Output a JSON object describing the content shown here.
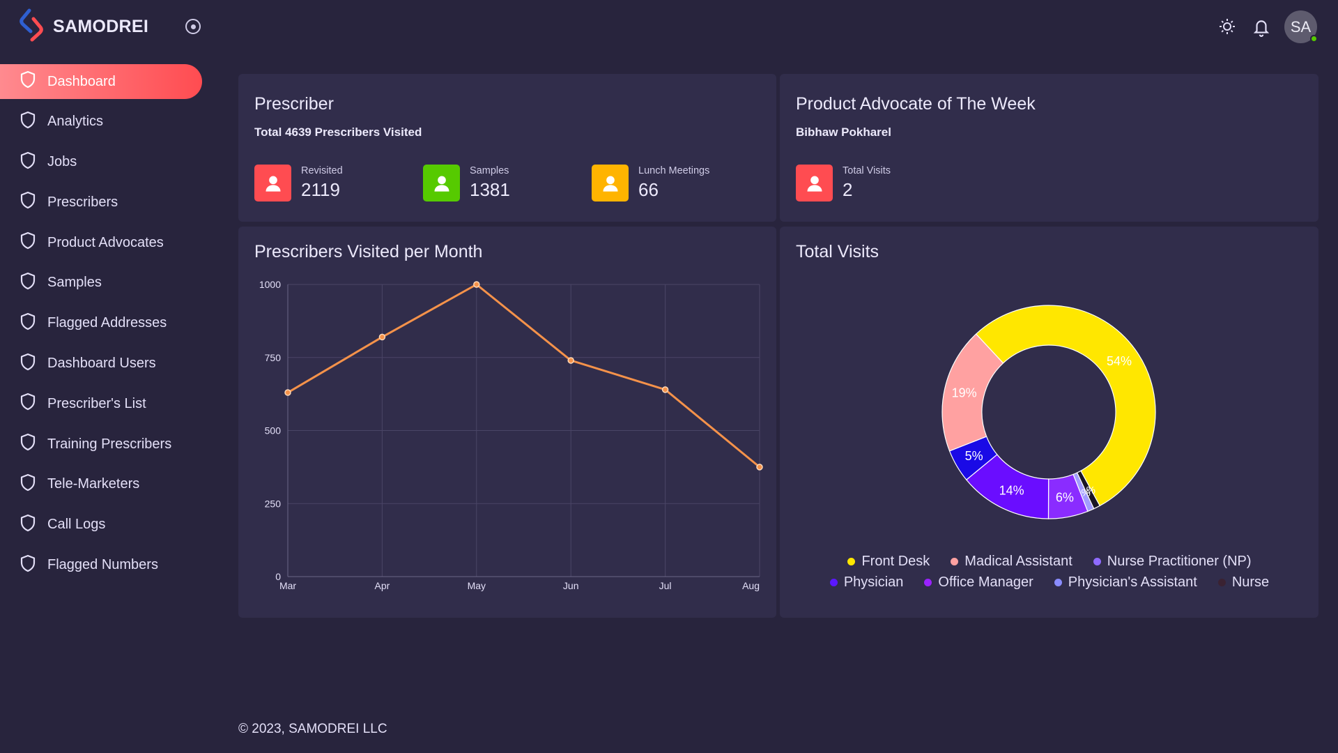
{
  "brand": {
    "name": "SAMODREI"
  },
  "user": {
    "initials": "SA"
  },
  "sidebar": {
    "items": [
      {
        "label": "Dashboard",
        "active": true
      },
      {
        "label": "Analytics"
      },
      {
        "label": "Jobs"
      },
      {
        "label": "Prescribers"
      },
      {
        "label": "Product Advocates"
      },
      {
        "label": "Samples"
      },
      {
        "label": "Flagged Addresses"
      },
      {
        "label": "Dashboard Users"
      },
      {
        "label": "Prescriber's List"
      },
      {
        "label": "Training Prescribers"
      },
      {
        "label": "Tele-Marketers"
      },
      {
        "label": "Call Logs"
      },
      {
        "label": "Flagged Numbers"
      }
    ]
  },
  "prescriber": {
    "title": "Prescriber",
    "subtitle": "Total 4639 Prescribers Visited",
    "stats": [
      {
        "label": "Revisited",
        "value": "2119",
        "color": "#ff4c51"
      },
      {
        "label": "Samples",
        "value": "1381",
        "color": "#56ca00"
      },
      {
        "label": "Lunch Meetings",
        "value": "66",
        "color": "#ffb400"
      }
    ]
  },
  "advocate": {
    "title": "Product Advocate of The Week",
    "name": "Bibhaw Pokharel",
    "stat": {
      "label": "Total Visits",
      "value": "2",
      "color": "#ff4c51"
    }
  },
  "line_chart_card": {
    "title": "Prescribers Visited per Month"
  },
  "donut_card": {
    "title": "Total Visits"
  },
  "chart_data": [
    {
      "type": "line",
      "title": "Prescribers Visited per Month",
      "categories": [
        "Mar",
        "Apr",
        "May",
        "Jun",
        "Jul",
        "Aug"
      ],
      "series": [
        {
          "values": [
            630,
            820,
            1000,
            740,
            640,
            375
          ],
          "color": "#f5924a"
        }
      ],
      "ylim": [
        0,
        1000
      ],
      "yticks": [
        0,
        250,
        500,
        750,
        1000
      ],
      "grid": true
    },
    {
      "type": "pie",
      "title": "Total Visits",
      "donut": true,
      "slices": [
        {
          "name": "Front Desk",
          "value": 54,
          "label": "54%",
          "color": "#ffe700"
        },
        {
          "name": "Nurse",
          "value": 1,
          "label": "1%",
          "color": "#1a1625"
        },
        {
          "name": "Physician's Assistant",
          "value": 1,
          "label": "1%",
          "color": "#a29cff"
        },
        {
          "name": "Nurse Practitioner (NP)",
          "value": 6,
          "label": "6%",
          "color": "#8a2cff"
        },
        {
          "name": "Office Manager",
          "value": 14,
          "label": "14%",
          "color": "#6a0dff"
        },
        {
          "name": "Physician",
          "value": 5,
          "label": "5%",
          "color": "#1a0ae6"
        },
        {
          "name": "Madical Assistant",
          "value": 19,
          "label": "19%",
          "color": "#ffa1a1"
        }
      ],
      "legend": [
        {
          "name": "Front Desk",
          "color": "#ffe700"
        },
        {
          "name": "Madical Assistant",
          "color": "#ffa1a1"
        },
        {
          "name": "Nurse Practitioner (NP)",
          "color": "#8f6bff"
        },
        {
          "name": "Physician",
          "color": "#5b17ff"
        },
        {
          "name": "Office Manager",
          "color": "#9a22ff"
        },
        {
          "name": "Physician's Assistant",
          "color": "#8a8cff"
        },
        {
          "name": "Nurse",
          "color": "#3a2232"
        }
      ],
      "legend_position": "bottom"
    }
  ],
  "footer": {
    "text": "© 2023, SAMODREI LLC"
  }
}
